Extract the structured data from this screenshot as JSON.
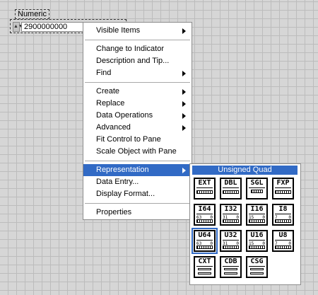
{
  "control": {
    "label": "Numeric",
    "value": "2900000000",
    "increment_icon": "increment-decrement-icon"
  },
  "menu": {
    "groups": [
      [
        {
          "label": "Visible Items",
          "submenu": true
        }
      ],
      [
        {
          "label": "Change to Indicator",
          "submenu": false
        },
        {
          "label": "Description and Tip...",
          "submenu": false
        },
        {
          "label": "Find",
          "submenu": true
        }
      ],
      [
        {
          "label": "Create",
          "submenu": true
        },
        {
          "label": "Replace",
          "submenu": true
        },
        {
          "label": "Data Operations",
          "submenu": true
        },
        {
          "label": "Advanced",
          "submenu": true
        },
        {
          "label": "Fit Control to Pane",
          "submenu": false
        },
        {
          "label": "Scale Object with Pane",
          "submenu": false
        }
      ],
      [
        {
          "label": "Representation",
          "submenu": true,
          "highlighted": true
        },
        {
          "label": "Data Entry...",
          "submenu": false
        },
        {
          "label": "Display Format...",
          "submenu": false
        }
      ],
      [
        {
          "label": "Properties",
          "submenu": false
        }
      ]
    ]
  },
  "representation": {
    "title": "Unsigned Quad",
    "selected": "U64",
    "types": [
      {
        "name": "EXT",
        "hi": "",
        "lo": ""
      },
      {
        "name": "DBL",
        "hi": "",
        "lo": ""
      },
      {
        "name": "SGL",
        "hi": "",
        "lo": ""
      },
      {
        "name": "FXP",
        "hi": "",
        "lo": ""
      },
      {
        "name": "I64",
        "hi": "63",
        "lo": "0"
      },
      {
        "name": "I32",
        "hi": "31",
        "lo": "0"
      },
      {
        "name": "I16",
        "hi": "15",
        "lo": "0"
      },
      {
        "name": "I8",
        "hi": "7",
        "lo": "0"
      },
      {
        "name": "U64",
        "hi": "63",
        "lo": "0"
      },
      {
        "name": "U32",
        "hi": "31",
        "lo": "0"
      },
      {
        "name": "U16",
        "hi": "15",
        "lo": "0"
      },
      {
        "name": "U8",
        "hi": "7",
        "lo": "0"
      },
      {
        "name": "CXT",
        "hi": "",
        "lo": ""
      },
      {
        "name": "CDB",
        "hi": "",
        "lo": ""
      },
      {
        "name": "CSG",
        "hi": "",
        "lo": ""
      }
    ]
  },
  "colors": {
    "highlight": "#316ac5",
    "canvas": "#d6d6d6",
    "grid": "#bcbcbc"
  }
}
